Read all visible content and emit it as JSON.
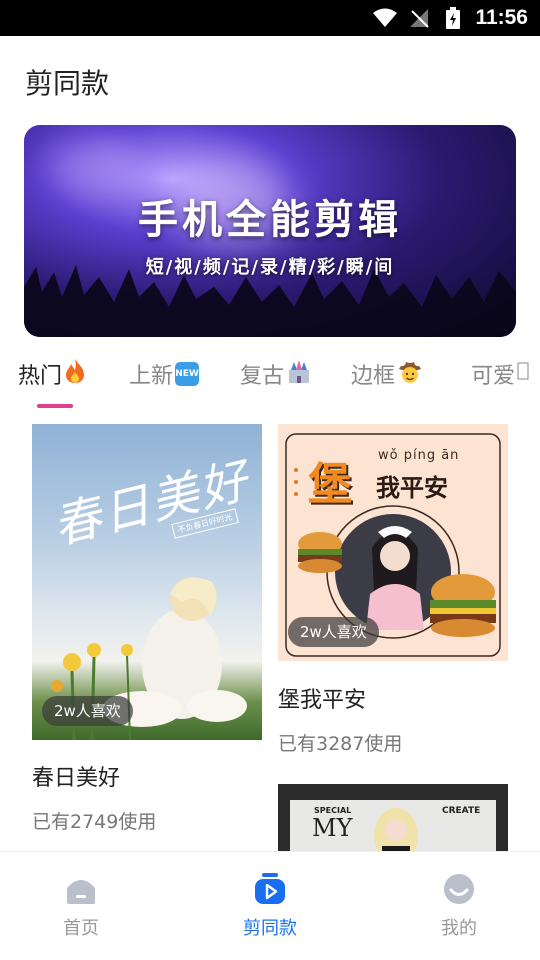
{
  "status_bar": {
    "time": "11:56"
  },
  "page": {
    "title": "剪同款"
  },
  "banner": {
    "headline": "手机全能剪辑",
    "subline": "短/视/频/记/录/精/彩/瞬/间"
  },
  "tabs": [
    {
      "label": "热门",
      "icon": "fire-emoji",
      "active": true
    },
    {
      "label": "上新",
      "icon": "new-emoji",
      "active": false
    },
    {
      "label": "复古",
      "icon": "castle-emoji",
      "active": false
    },
    {
      "label": "边框",
      "icon": "cowboy-emoji",
      "active": false
    },
    {
      "label": "可爱",
      "icon": "missing-glyph",
      "active": false
    }
  ],
  "cards": [
    {
      "title": "春日美好",
      "usage": "已有2749使用",
      "likes": "2w人喜欢",
      "art_text": "春日美好",
      "art_subtext": "不负春日好时光"
    },
    {
      "title": "堡我平安",
      "usage": "已有3287使用",
      "likes": "2w人喜欢",
      "art_pinyin": "wǒ píng ān",
      "art_big": "堡",
      "art_rest": "我平安"
    },
    {
      "title": "",
      "usage": "",
      "art_left": "SPECIAL",
      "art_big": "MY",
      "art_right": "CREATE"
    }
  ],
  "bottom_nav": [
    {
      "label": "首页",
      "icon": "home-icon",
      "active": false
    },
    {
      "label": "剪同款",
      "icon": "play-template-icon",
      "active": true
    },
    {
      "label": "我的",
      "icon": "profile-icon",
      "active": false
    }
  ],
  "colors": {
    "accent": "#1a6ff0",
    "tab_indicator": "#e0408a"
  }
}
